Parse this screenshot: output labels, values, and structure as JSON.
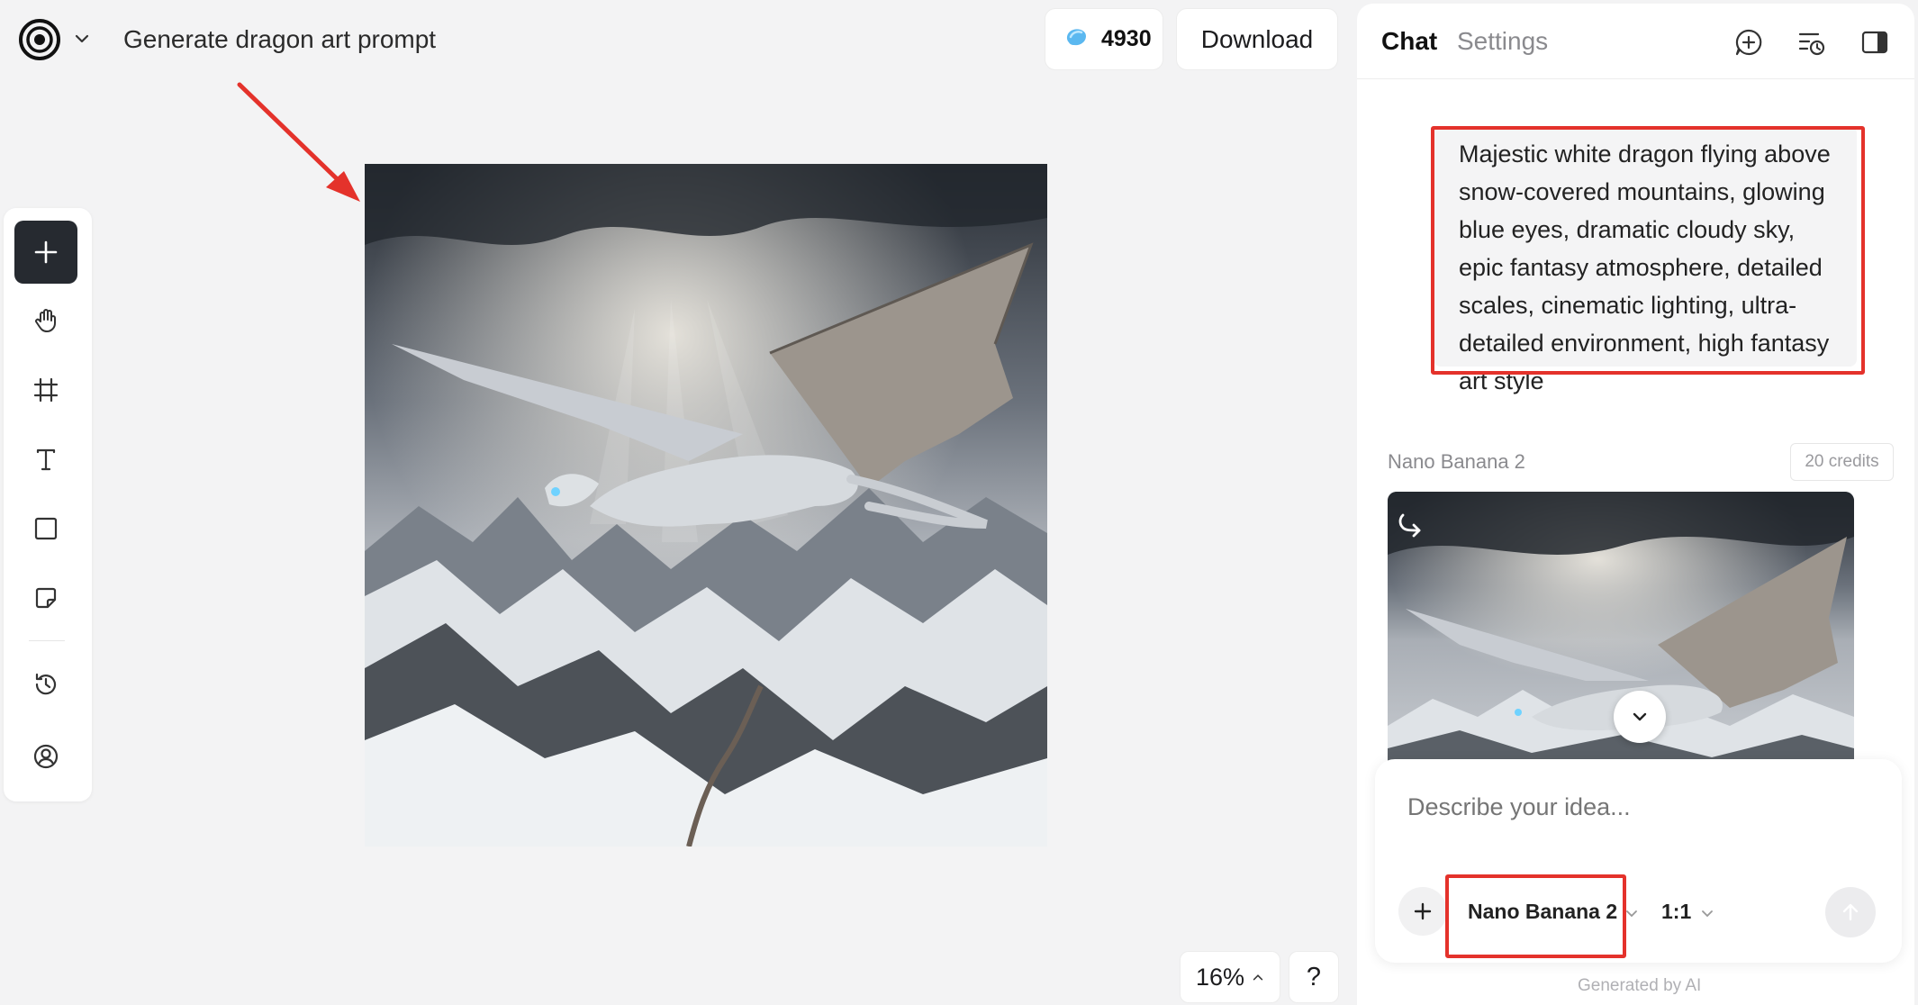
{
  "header": {
    "title": "Generate dragon art prompt",
    "credits": "4930",
    "download_label": "Download"
  },
  "toolbar": {
    "tools": [
      "add",
      "hand",
      "frame",
      "text",
      "rectangle",
      "sticky-note",
      "history",
      "profile"
    ]
  },
  "canvas": {
    "zoom": "16%",
    "help_label": "?"
  },
  "panel": {
    "tab_chat": "Chat",
    "tab_settings": "Settings",
    "prompt_text": "Majestic white dragon flying above snow-covered mountains, glowing blue eyes, dramatic cloudy sky, epic fantasy atmosphere, detailed scales, cinematic lighting, ultra-detailed environment, high fantasy art style",
    "result_model": "Nano Banana 2",
    "result_credits": "20 credits"
  },
  "composer": {
    "placeholder": "Describe your idea...",
    "model": "Nano Banana 2",
    "ratio": "1:1",
    "footnote": "Generated by AI"
  },
  "colors": {
    "annotation_red": "#e4322b",
    "active_tool": "#262a30",
    "credit_gem": "#5bb8f0"
  }
}
